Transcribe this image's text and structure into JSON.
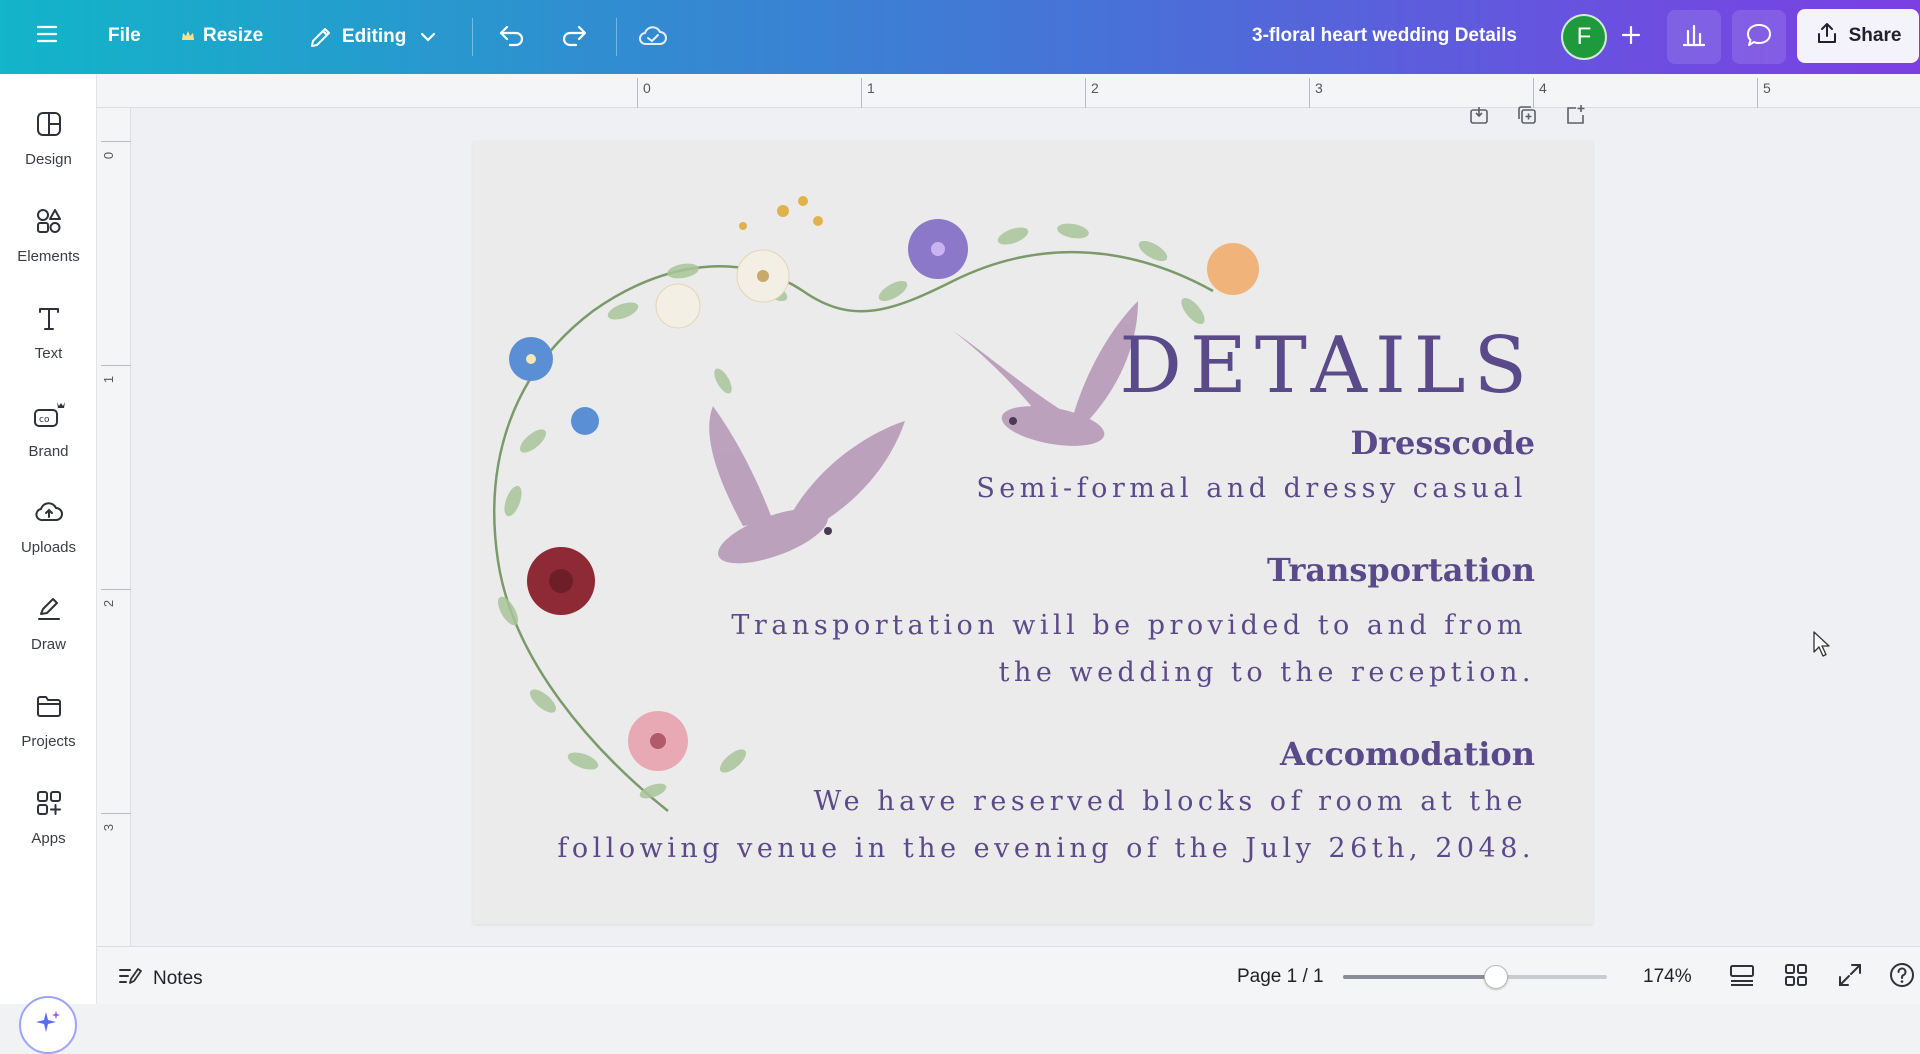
{
  "topbar": {
    "file_label": "File",
    "resize_label": "Resize",
    "editing_label": "Editing",
    "title": "3-floral heart wedding Details",
    "avatar_initial": "F",
    "share_label": "Share",
    "gradient_start": "#12b5c9",
    "gradient_end": "#7b3fe4",
    "avatar_color": "#1e9a3c"
  },
  "sidebar": {
    "items": [
      {
        "label": "Design",
        "icon": "design-icon"
      },
      {
        "label": "Elements",
        "icon": "elements-icon"
      },
      {
        "label": "Text",
        "icon": "text-icon"
      },
      {
        "label": "Brand",
        "icon": "brand-icon"
      },
      {
        "label": "Uploads",
        "icon": "uploads-icon"
      },
      {
        "label": "Draw",
        "icon": "draw-icon"
      },
      {
        "label": "Projects",
        "icon": "projects-icon"
      },
      {
        "label": "Apps",
        "icon": "apps-icon"
      }
    ],
    "magic_icon": "magic-sparkle-icon"
  },
  "rulers": {
    "top": [
      "0",
      "1",
      "2",
      "3",
      "4",
      "5"
    ],
    "left": [
      "0",
      "1",
      "2",
      "3"
    ]
  },
  "design": {
    "heading": "DETAILS",
    "sections": [
      {
        "title": "Dresscode",
        "lines": [
          "Semi-formal and dressy casual"
        ]
      },
      {
        "title": "Transportation",
        "lines": [
          "Transportation will be provided to and from",
          "the wedding to the reception."
        ]
      },
      {
        "title": "Accomodation",
        "lines": [
          "We have reserved blocks of room at the",
          "following venue in the evening of the July 26th, 2048."
        ]
      }
    ],
    "text_color": "#5b4a8a",
    "background_color": "#ebebeb"
  },
  "statusbar": {
    "notes_label": "Notes",
    "page_info": "Page 1 / 1",
    "zoom_label": "174%",
    "zoom_fraction": 0.58
  }
}
